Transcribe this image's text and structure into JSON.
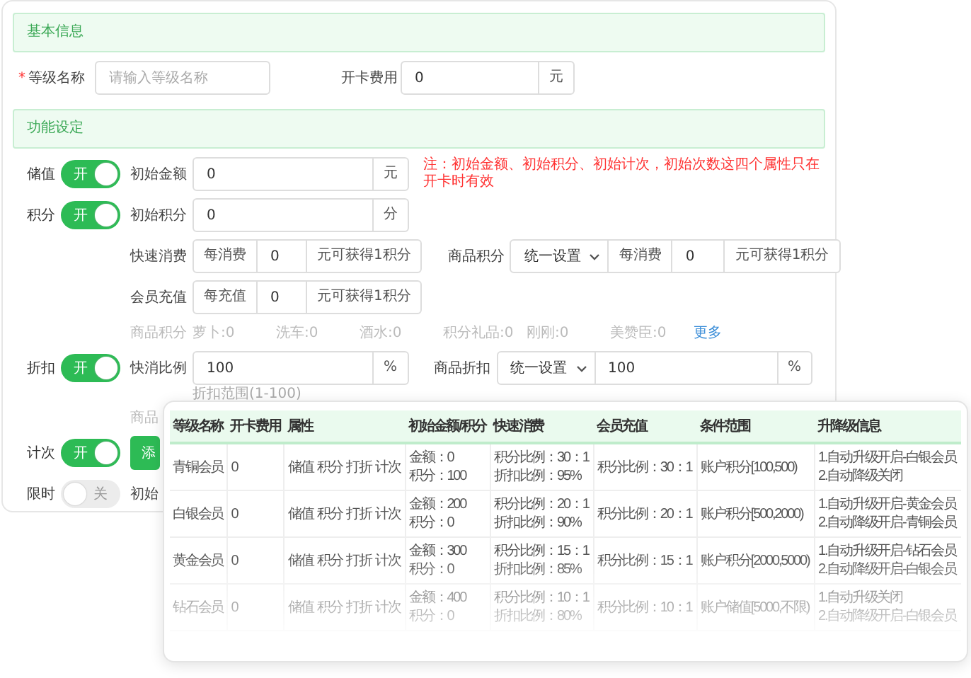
{
  "basic_section": {
    "title": "基本信息"
  },
  "level_name": {
    "label": "等级名称",
    "required_mark": "*",
    "placeholder": "请输入等级名称"
  },
  "card_fee": {
    "label": "开卡费用",
    "value": "0",
    "unit": "元"
  },
  "function_section": {
    "title": "功能设定"
  },
  "stored_value": {
    "label": "储值",
    "toggle": {
      "on": true,
      "text": "开"
    },
    "field_label": "初始金额",
    "value": "0",
    "unit": "元",
    "note": "注：初始金额、初始积分、初始计次，初始次数这四个属性只在开卡时有效"
  },
  "points": {
    "label": "积分",
    "toggle": {
      "on": true,
      "text": "开"
    },
    "field_label": "初始积分",
    "value": "0",
    "unit": "分",
    "quick_consume": {
      "label": "快速消费",
      "prefix": "每消费",
      "value": "0",
      "suffix": "元可获得1积分"
    },
    "goods_points": {
      "label": "商品积分",
      "select": "统一设置",
      "prefix": "每消费",
      "value": "0",
      "suffix": "元可获得1积分"
    },
    "recharge": {
      "label": "会员充值",
      "prefix": "每充值",
      "value": "0",
      "suffix": "元可获得1积分"
    },
    "goods_list": {
      "label": "商品积分",
      "items": [
        "萝卜:0",
        "洗车:0",
        "酒水:0",
        "积分礼品:0",
        "刚刚:0",
        "美赞臣:0"
      ],
      "more": "更多"
    }
  },
  "discount": {
    "label": "折扣",
    "toggle": {
      "on": true,
      "text": "开"
    },
    "field_label": "快消比例",
    "value": "100",
    "unit": "%",
    "hint": "折扣范围(1-100)",
    "goods_discount": {
      "label": "商品折扣",
      "select": "统一设置",
      "value": "100",
      "unit": "%"
    },
    "goods_label": "商品"
  },
  "count": {
    "label": "计次",
    "toggle": {
      "on": true,
      "text": "开"
    },
    "button": "添"
  },
  "time_limit": {
    "label": "限时",
    "toggle": {
      "on": false,
      "text": "关"
    },
    "field_label": "初始"
  },
  "level_table": {
    "columns": [
      "等级名称",
      "开卡费用",
      "属性",
      "初始金额/积分",
      "快速消费",
      "会员充值",
      "条件范围",
      "升降级信息"
    ],
    "rows": [
      {
        "cells": [
          "青铜会员",
          "0",
          "储值 积分 打折 计次",
          "金额：0\n积分：100",
          "积分比例：30：1\n折扣比例：95%",
          "积分比例：30：1",
          "账户积分[100,500)",
          "1.自动升级开启-白银会员\n2.自动降级关闭"
        ]
      },
      {
        "cells": [
          "白银会员",
          "0",
          "储值 积分 打折 计次",
          "金额：200\n积分：0",
          "积分比例：20：1\n折扣比例：90%",
          "积分比例：20：1",
          "账户积分[500,2000)",
          "1.自动升级开启-黄金会员\n2.自动降级开启-青铜会员"
        ]
      },
      {
        "cells": [
          "黄金会员",
          "0",
          "储值 积分 打折 计次",
          "金额：300\n积分：0",
          "积分比例：15：1\n折扣比例：85%",
          "积分比例：15：1",
          "账户积分[2000,5000)",
          "1.自动升级开启-钻石会员\n2.自动降级开启-白银会员"
        ]
      },
      {
        "cells": [
          "钻石会员",
          "0",
          "储值 积分 打折 计次",
          "金额：400\n积分：0",
          "积分比例：10：1\n折扣比例：80%",
          "积分比例：10：1",
          "账户储值[5000,不限)",
          "1.自动升级关闭\n2.自动降级开启-白银会员"
        ]
      }
    ]
  }
}
